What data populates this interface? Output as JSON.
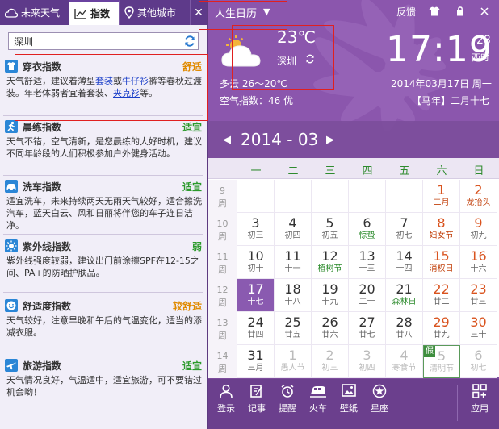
{
  "left": {
    "tabs": [
      {
        "label": "未来天气",
        "icon": "cloud-icon"
      },
      {
        "label": "指数",
        "icon": "chart-icon"
      },
      {
        "label": "其他城市",
        "icon": "location-pin-icon"
      }
    ],
    "close_glyph": "✕",
    "search": {
      "value": "深圳",
      "placeholder": ""
    },
    "indices": [
      {
        "title": "穿衣指数",
        "level": "舒适",
        "desc_pre": "天气舒适，建议着薄型",
        "link1": "套装",
        "mid": "或",
        "link2": "牛仔衫",
        "desc_mid": "裤等春秋过渡装。年老体弱者宜着套装、",
        "link3": "夹克衫",
        "desc_post": "等。"
      },
      {
        "title": "晨练指数",
        "level": "适宜",
        "desc": "天气不错，空气清新，是您晨练的大好时机，建议不同年龄段的人们积极参加户外健身活动。"
      },
      {
        "title": "洗车指数",
        "level": "适宜",
        "desc": "适宜洗车，未来持续两天无雨天气较好，适合擦洗汽车，蓝天白云、风和日丽将伴您的车子连日洁净。"
      },
      {
        "title": "紫外线指数",
        "level": "弱",
        "desc": "紫外线强度较弱，建议出门前涂擦SPF在12-15之间、PA+的防晒护肤品。"
      },
      {
        "title": "舒适度指数",
        "level": "较舒适",
        "desc": "天气较好，注意早晚和午后的气温变化，适当的添减衣服。"
      },
      {
        "title": "旅游指数",
        "level": "适宜",
        "desc": "天气情况良好，气温适中，适宜旅游，可不要错过机会哟！"
      }
    ]
  },
  "right": {
    "title": "人生日历",
    "title_arrow": "▼",
    "feedback": "反馈",
    "weather": {
      "temp": "23℃",
      "city": "深圳",
      "desc": "多云 26～20℃",
      "air": "空气指数：46 优"
    },
    "clock": {
      "hm": "17:19",
      "sec": "28",
      "zone": "西时"
    },
    "date_line": "2014年03月17日 周一",
    "lunar_line": "【马年】二月十七",
    "month": "2014 - 03",
    "prev": "◀",
    "next": "▶",
    "weekdays": [
      "一",
      "二",
      "三",
      "四",
      "五",
      "六",
      "日"
    ],
    "week_unit": "周",
    "weeks": [
      {
        "no": "9",
        "days": [
          {
            "d": "",
            "l": ""
          },
          {
            "d": "",
            "l": ""
          },
          {
            "d": "",
            "l": ""
          },
          {
            "d": "",
            "l": ""
          },
          {
            "d": "",
            "l": ""
          },
          {
            "d": "1",
            "l": "二月"
          },
          {
            "d": "2",
            "l": "龙抬头"
          }
        ]
      },
      {
        "no": "10",
        "days": [
          {
            "d": "3",
            "l": "初三"
          },
          {
            "d": "4",
            "l": "初四"
          },
          {
            "d": "5",
            "l": "初五"
          },
          {
            "d": "6",
            "l": "惊蛰"
          },
          {
            "d": "7",
            "l": "初七"
          },
          {
            "d": "8",
            "l": "妇女节"
          },
          {
            "d": "9",
            "l": "初九"
          }
        ]
      },
      {
        "no": "11",
        "days": [
          {
            "d": "10",
            "l": "初十"
          },
          {
            "d": "11",
            "l": "十一"
          },
          {
            "d": "12",
            "l": "植树节"
          },
          {
            "d": "13",
            "l": "十三"
          },
          {
            "d": "14",
            "l": "十四"
          },
          {
            "d": "15",
            "l": "消权日"
          },
          {
            "d": "16",
            "l": "十六"
          }
        ]
      },
      {
        "no": "12",
        "days": [
          {
            "d": "17",
            "l": "十七"
          },
          {
            "d": "18",
            "l": "十八"
          },
          {
            "d": "19",
            "l": "十九"
          },
          {
            "d": "20",
            "l": "二十"
          },
          {
            "d": "21",
            "l": "森林日"
          },
          {
            "d": "22",
            "l": "廿二"
          },
          {
            "d": "23",
            "l": "廿三"
          }
        ]
      },
      {
        "no": "13",
        "days": [
          {
            "d": "24",
            "l": "廿四"
          },
          {
            "d": "25",
            "l": "廿五"
          },
          {
            "d": "26",
            "l": "廿六"
          },
          {
            "d": "27",
            "l": "廿七"
          },
          {
            "d": "28",
            "l": "廿八"
          },
          {
            "d": "29",
            "l": "廿九"
          },
          {
            "d": "30",
            "l": "三十"
          }
        ]
      },
      {
        "no": "14",
        "days": [
          {
            "d": "31",
            "l": "三月"
          },
          {
            "d": "1",
            "l": "愚人节"
          },
          {
            "d": "2",
            "l": "初三"
          },
          {
            "d": "3",
            "l": "初四"
          },
          {
            "d": "4",
            "l": "寒食节"
          },
          {
            "d": "5",
            "l": "清明节"
          },
          {
            "d": "6",
            "l": "初七"
          }
        ]
      }
    ],
    "holiday_tag": "假",
    "toolbar": [
      {
        "label": "登录",
        "icon": "user-icon"
      },
      {
        "label": "记事",
        "icon": "notepad-icon"
      },
      {
        "label": "提醒",
        "icon": "alarm-icon"
      },
      {
        "label": "火车",
        "icon": "train-icon"
      },
      {
        "label": "壁纸",
        "icon": "picture-icon"
      },
      {
        "label": "星座",
        "icon": "star-icon"
      }
    ],
    "app_label": "应用",
    "colors": {
      "accent": "#7c4c9c",
      "green": "#2b9a2b",
      "orange": "#e08a00",
      "red": "#d9531e"
    }
  }
}
